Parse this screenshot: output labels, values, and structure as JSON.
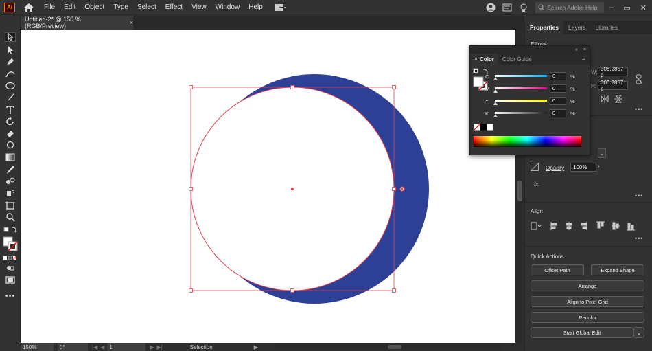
{
  "app": {
    "logo_text": "Ai"
  },
  "menu": [
    "File",
    "Edit",
    "Object",
    "Type",
    "Select",
    "Effect",
    "View",
    "Window",
    "Help"
  ],
  "search": {
    "placeholder": "Search Adobe Help"
  },
  "document_tab": {
    "title": "Untitled-2* @ 150 % (RGB/Preview)",
    "close": "×"
  },
  "statusbar": {
    "zoom": "150%",
    "rotation": "0°",
    "artboard": "1",
    "mode": "Selection"
  },
  "properties_panel": {
    "tabs": [
      "Properties",
      "Layers",
      "Libraries"
    ],
    "section_title": "Ellipse",
    "width_label": "W:",
    "height_label": "H:",
    "width_value": "306.2857 p",
    "height_value": "306.2857 p",
    "opacity_label": "Opacity",
    "opacity_value": "100%",
    "fx_label": "fx.",
    "align_title": "Align",
    "quick_actions_title": "Quick Actions",
    "buttons": {
      "offset_path": "Offset Path",
      "expand_shape": "Expand Shape",
      "arrange": "Arrange",
      "align_pixel": "Align to Pixel Grid",
      "recolor": "Recolor",
      "global_edit": "Start Global Edit"
    }
  },
  "color_panel": {
    "tabs": [
      "Color",
      "Color Guide"
    ],
    "channels": [
      {
        "label": "C",
        "value": "0",
        "unit": "%"
      },
      {
        "label": "M",
        "value": "0",
        "unit": "%"
      },
      {
        "label": "Y",
        "value": "0",
        "unit": "%"
      },
      {
        "label": "K",
        "value": "0",
        "unit": "%"
      }
    ],
    "top_buttons": [
      "«",
      "×"
    ]
  },
  "colors": {
    "crescent_fill": "#2e3f96",
    "selection": "#e5404f",
    "artboard": "#ffffff",
    "ui_dark": "#323232"
  }
}
